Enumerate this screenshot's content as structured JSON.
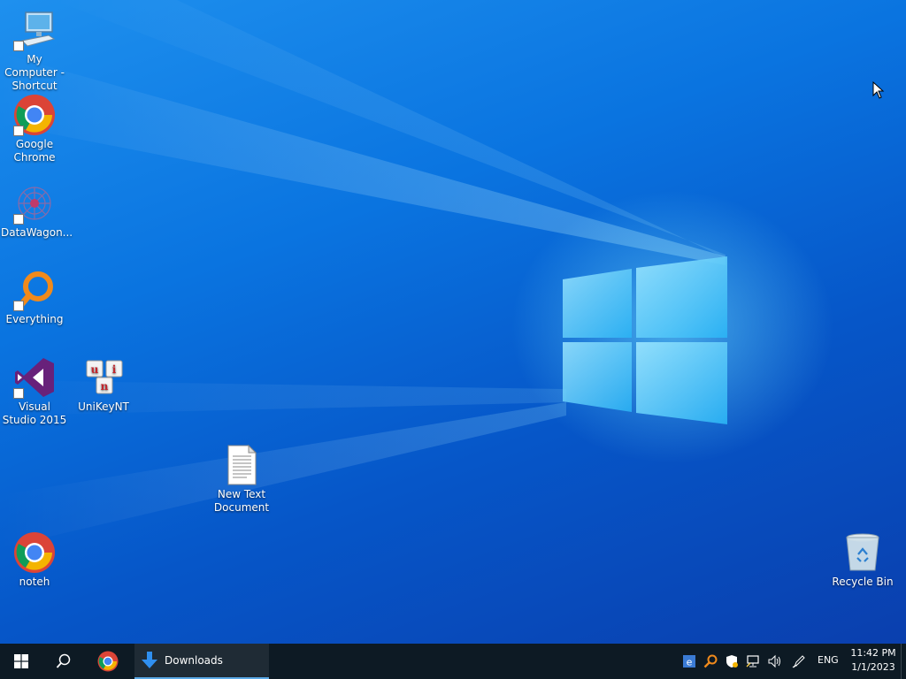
{
  "desktop": {
    "icons": [
      {
        "id": "my-computer",
        "label": "My Computer - Shortcut",
        "icon": "monitor-icon"
      },
      {
        "id": "google-chrome",
        "label": "Google Chrome",
        "icon": "chrome-icon"
      },
      {
        "id": "datawagon",
        "label": "DataWagon...",
        "icon": "datawagon-icon"
      },
      {
        "id": "everything",
        "label": "Everything",
        "icon": "everything-search-icon"
      },
      {
        "id": "visual-studio",
        "label": "Visual Studio 2015",
        "icon": "visual-studio-icon"
      },
      {
        "id": "unikey",
        "label": "UniKeyNT",
        "icon": "unikey-icon"
      },
      {
        "id": "new-text-document",
        "label": "New Text Document",
        "icon": "text-document-icon"
      },
      {
        "id": "noteh",
        "label": "noteh",
        "icon": "chrome-icon"
      },
      {
        "id": "recycle-bin",
        "label": "Recycle Bin",
        "icon": "recycle-bin-icon"
      }
    ],
    "wallpaper": {
      "accent": "#0a74e0",
      "logo": "windows-logo"
    }
  },
  "taskbar": {
    "start_icon": "windows-start-icon",
    "search_icon": "search-icon",
    "pinned": [
      {
        "name": "Google Chrome",
        "icon": "chrome-icon"
      }
    ],
    "open_window": {
      "label": "Downloads",
      "icon": "download-arrow-icon"
    },
    "tray": {
      "icons": [
        "edge-icon",
        "everything-tray-icon",
        "security-shield-icon",
        "network-icon",
        "volume-icon",
        "pen-icon"
      ],
      "language": "ENG",
      "time": "11:42 PM",
      "date": "1/1/2023"
    },
    "background": "#0d1a24"
  }
}
